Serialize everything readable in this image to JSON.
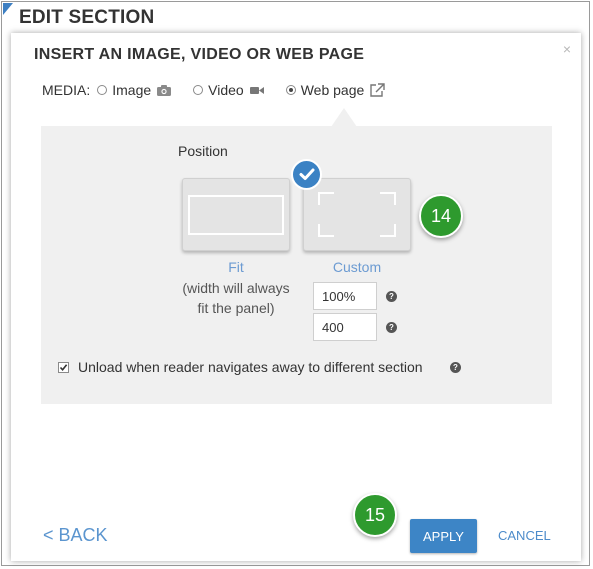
{
  "header": {
    "title": "EDIT SECTION"
  },
  "dialog": {
    "title": "INSERT AN IMAGE, VIDEO OR WEB PAGE",
    "close": "×"
  },
  "media": {
    "label": "MEDIA:",
    "options": [
      {
        "label": "Image",
        "icon": "camera-icon",
        "selected": false
      },
      {
        "label": "Video",
        "icon": "video-camera-icon",
        "selected": false
      },
      {
        "label": "Web page",
        "icon": "external-link-icon",
        "selected": true
      }
    ]
  },
  "position": {
    "label": "Position",
    "fit_label": "Fit",
    "fit_desc_line1": "(width will always",
    "fit_desc_line2": "fit the panel)",
    "custom_label": "Custom",
    "selected": "Custom",
    "width_value": "100%",
    "height_value": "400"
  },
  "unload": {
    "label": "Unload when reader navigates away to different section",
    "checked": true
  },
  "callouts": {
    "step14": "14",
    "step15": "15"
  },
  "footer": {
    "back_label": "< BACK",
    "apply_label": "APPLY",
    "cancel_label": "CANCEL"
  },
  "colors": {
    "accent": "#3d85c6",
    "link": "#5b95cf",
    "callout_green": "#2e9a2e",
    "panel_bg": "#f0f0f0"
  }
}
